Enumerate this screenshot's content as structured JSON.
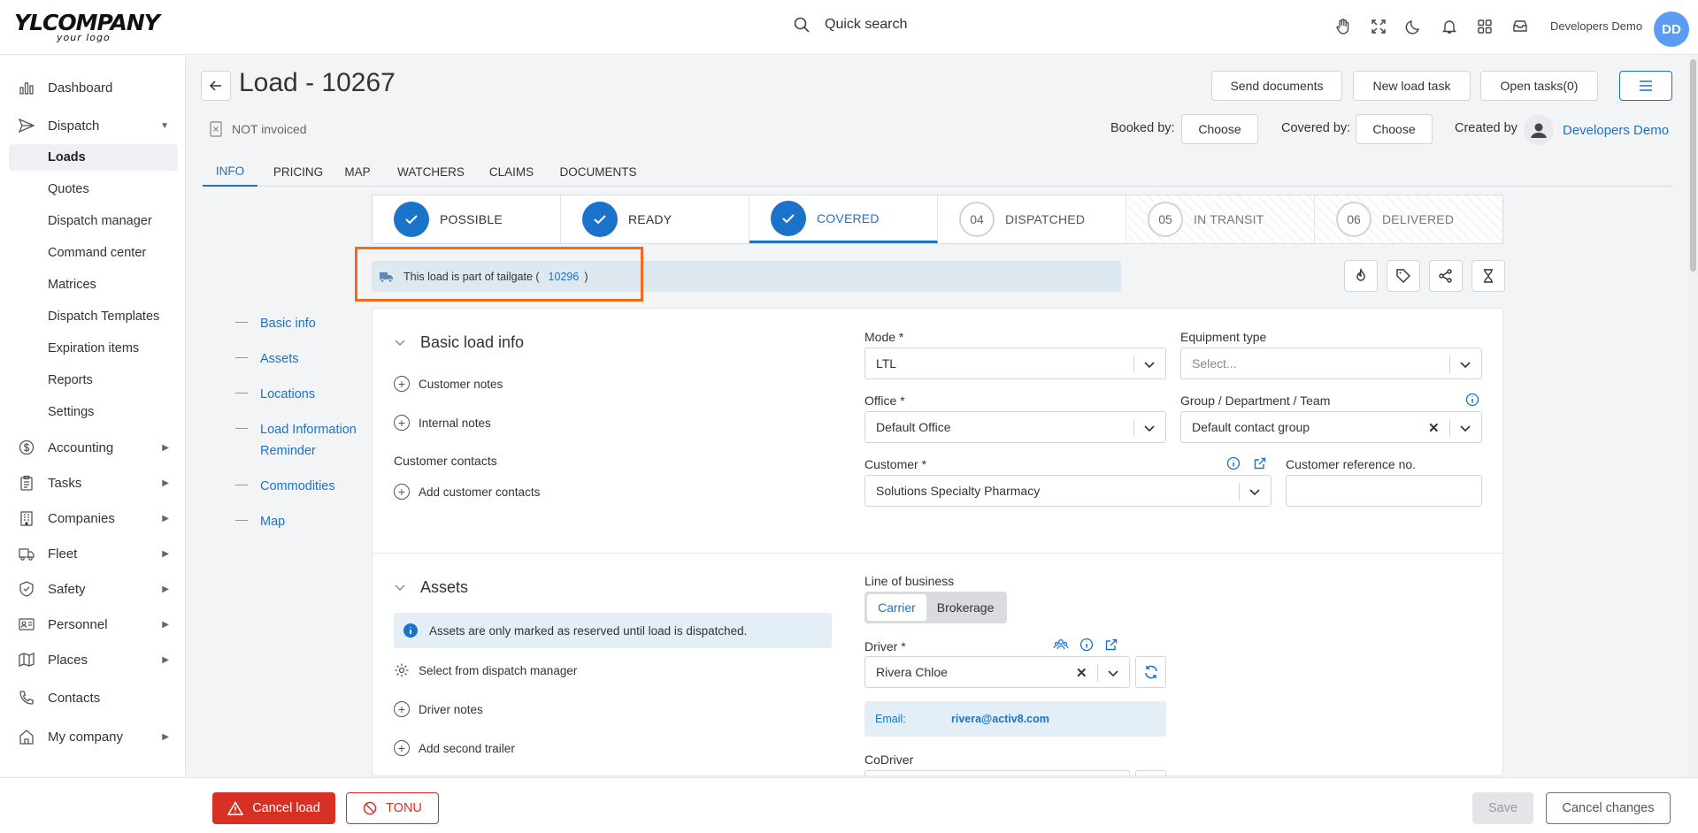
{
  "header": {
    "logo_main": "YLCOMPANY",
    "logo_sub": "your logo",
    "search_label": "Quick search",
    "user_name": "Developers Demo",
    "user_initials": "DD",
    "icons": [
      "hand-icon",
      "fullscreen-icon",
      "moon-icon",
      "bell-icon",
      "apps-grid-icon",
      "inbox-icon"
    ]
  },
  "sidebar": {
    "items": [
      {
        "label": "Dashboard",
        "icon": "chart-icon"
      },
      {
        "label": "Dispatch",
        "icon": "send-icon",
        "expanded": true
      },
      {
        "label": "Accounting",
        "icon": "dollar-icon"
      },
      {
        "label": "Tasks",
        "icon": "clipboard-icon"
      },
      {
        "label": "Companies",
        "icon": "building-icon"
      },
      {
        "label": "Fleet",
        "icon": "truck-icon"
      },
      {
        "label": "Safety",
        "icon": "shield-icon"
      },
      {
        "label": "Personnel",
        "icon": "id-card-icon"
      },
      {
        "label": "Places",
        "icon": "map-icon"
      },
      {
        "label": "Contacts",
        "icon": "phone-icon"
      },
      {
        "label": "My company",
        "icon": "home-icon"
      }
    ],
    "dispatch_sub": [
      "Loads",
      "Quotes",
      "Dispatch manager",
      "Command center",
      "Matrices",
      "Dispatch Templates",
      "Expiration items",
      "Reports",
      "Settings"
    ],
    "active_sub": "Loads"
  },
  "page": {
    "title": "Load - 10267",
    "invoice_status": "NOT invoiced",
    "buttons": {
      "send_documents": "Send documents",
      "new_load_task": "New load task",
      "open_tasks": "Open tasks(0)"
    },
    "booked_by_label": "Booked by:",
    "covered_by_label": "Covered by:",
    "choose": "Choose",
    "created_by_label": "Created by",
    "created_by_user": "Developers Demo"
  },
  "tabs": [
    "INFO",
    "PRICING",
    "MAP",
    "WATCHERS",
    "CLAIMS",
    "DOCUMENTS"
  ],
  "active_tab": "INFO",
  "stepper": [
    {
      "label": "POSSIBLE",
      "status": "done"
    },
    {
      "label": "READY",
      "status": "done"
    },
    {
      "label": "COVERED",
      "status": "current"
    },
    {
      "label": "DISPATCHED",
      "num": "04",
      "status": "pending"
    },
    {
      "label": "IN TRANSIT",
      "num": "05",
      "status": "pending"
    },
    {
      "label": "DELIVERED",
      "num": "06",
      "status": "pending"
    }
  ],
  "tailgate": {
    "text": "This load is part of tailgate (",
    "id": "10296",
    "close": ")"
  },
  "anchors": [
    "Basic info",
    "Assets",
    "Locations",
    "Load Information Reminder",
    "Commodities",
    "Map"
  ],
  "basic": {
    "title": "Basic load info",
    "customer_notes": "Customer notes",
    "internal_notes": "Internal notes",
    "customer_contacts_label": "Customer contacts",
    "add_customer_contacts": "Add customer contacts",
    "mode_label": "Mode *",
    "mode_value": "LTL",
    "equipment_label": "Equipment type",
    "equipment_placeholder": "Select...",
    "office_label": "Office *",
    "office_value": "Default Office",
    "group_label": "Group / Department / Team",
    "group_value": "Default contact group",
    "customer_label": "Customer *",
    "customer_value": "Solutions Specialty Pharmacy",
    "customer_ref_label": "Customer reference no."
  },
  "assets": {
    "title": "Assets",
    "alert": "Assets are only marked as reserved until load is dispatched.",
    "select_dispatch": "Select from dispatch manager",
    "driver_notes": "Driver notes",
    "add_second_trailer": "Add second trailer",
    "line_of_business_label": "Line of business",
    "lob_options": [
      "Carrier",
      "Brokerage"
    ],
    "lob_selected": "Carrier",
    "driver_label": "Driver *",
    "driver_value": "Rivera Chloe",
    "email_key": "Email:",
    "email_value": "rivera@activ8.com",
    "codriver_label": "CoDriver"
  },
  "footer": {
    "cancel_load": "Cancel load",
    "tonu": "TONU",
    "save": "Save",
    "cancel_changes": "Cancel changes"
  },
  "colors": {
    "accent": "#1a73c8",
    "danger": "#d93025",
    "highlight": "#ef6c1e",
    "info_bg": "#e3eef6"
  }
}
